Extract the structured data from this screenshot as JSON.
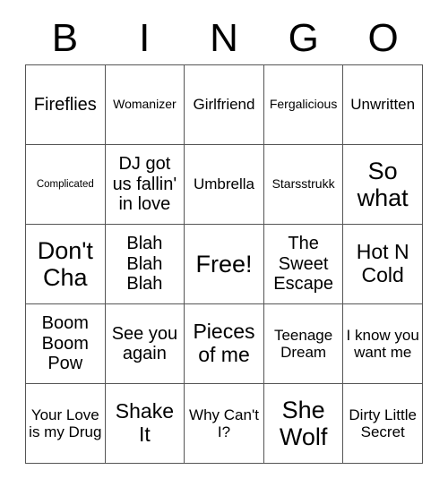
{
  "card": {
    "header": {
      "letters": [
        "B",
        "I",
        "N",
        "G",
        "O"
      ]
    },
    "grid": {
      "rows": 5,
      "columns": 5,
      "border_color": "#555555",
      "background_color": "#ffffff",
      "text_color": "#000000",
      "cells": [
        {
          "text": "Fireflies",
          "size": "lg"
        },
        {
          "text": "Womanizer",
          "size": "sm"
        },
        {
          "text": "Girlfriend",
          "size": "md"
        },
        {
          "text": "Fergalicious",
          "size": "sm"
        },
        {
          "text": "Unwritten",
          "size": "md"
        },
        {
          "text": "Complicated",
          "size": "xs"
        },
        {
          "text": "DJ got us fallin' in love",
          "size": "lg"
        },
        {
          "text": "Umbrella",
          "size": "md"
        },
        {
          "text": "Starsstrukk",
          "size": "sm"
        },
        {
          "text": "So what",
          "size": "xxl"
        },
        {
          "text": "Don't Cha",
          "size": "xxl"
        },
        {
          "text": "Blah Blah Blah",
          "size": "lg"
        },
        {
          "text": "Free!",
          "size": "xxl"
        },
        {
          "text": "The Sweet Escape",
          "size": "lg"
        },
        {
          "text": "Hot N Cold",
          "size": "xl"
        },
        {
          "text": "Boom Boom Pow",
          "size": "lg"
        },
        {
          "text": "See you again",
          "size": "lg"
        },
        {
          "text": "Pieces of me",
          "size": "xl"
        },
        {
          "text": "Teenage Dream",
          "size": "md"
        },
        {
          "text": "I know you want me",
          "size": "md"
        },
        {
          "text": "Your Love is my Drug",
          "size": "md"
        },
        {
          "text": "Shake It",
          "size": "xl"
        },
        {
          "text": "Why Can't I?",
          "size": "md"
        },
        {
          "text": "She Wolf",
          "size": "xxl"
        },
        {
          "text": "Dirty Little Secret",
          "size": "md"
        }
      ]
    }
  }
}
